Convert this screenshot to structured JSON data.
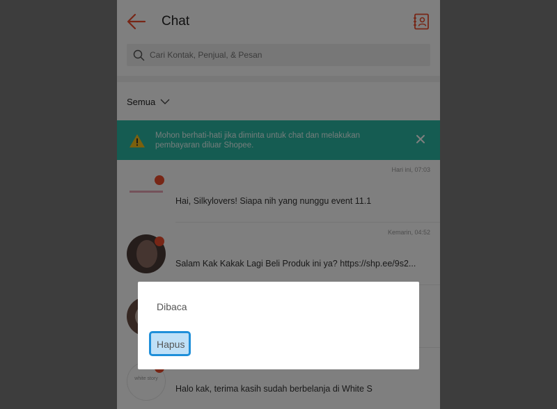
{
  "header": {
    "title": "Chat"
  },
  "search": {
    "placeholder": "Cari Kontak, Penjual, & Pesan"
  },
  "filter": {
    "label": "Semua"
  },
  "notice": {
    "text": "Mohon berhati-hati jika diminta untuk chat dan melakukan pembayaran diluar Shopee."
  },
  "chats": [
    {
      "time": "Hari ini, 07:03",
      "message": "Hai, Silkylovers! Siapa nih yang nunggu event 11.1"
    },
    {
      "time": "Kemarin, 04:52",
      "message": "Salam Kak    Kakak Lagi Beli Produk ini ya?  https://shp.ee/9s2..."
    },
    {
      "time": "",
      "message": ""
    },
    {
      "time": "",
      "message": "Halo kak, terima kasih sudah berbelanja di White S",
      "avatar_text": "white story"
    }
  ],
  "dialog": {
    "read_label": "Dibaca",
    "delete_label": "Hapus"
  },
  "colors": {
    "accent": "#ee4d2d",
    "notice": "#2bb8a5",
    "highlight_border": "#1f8fd9"
  }
}
